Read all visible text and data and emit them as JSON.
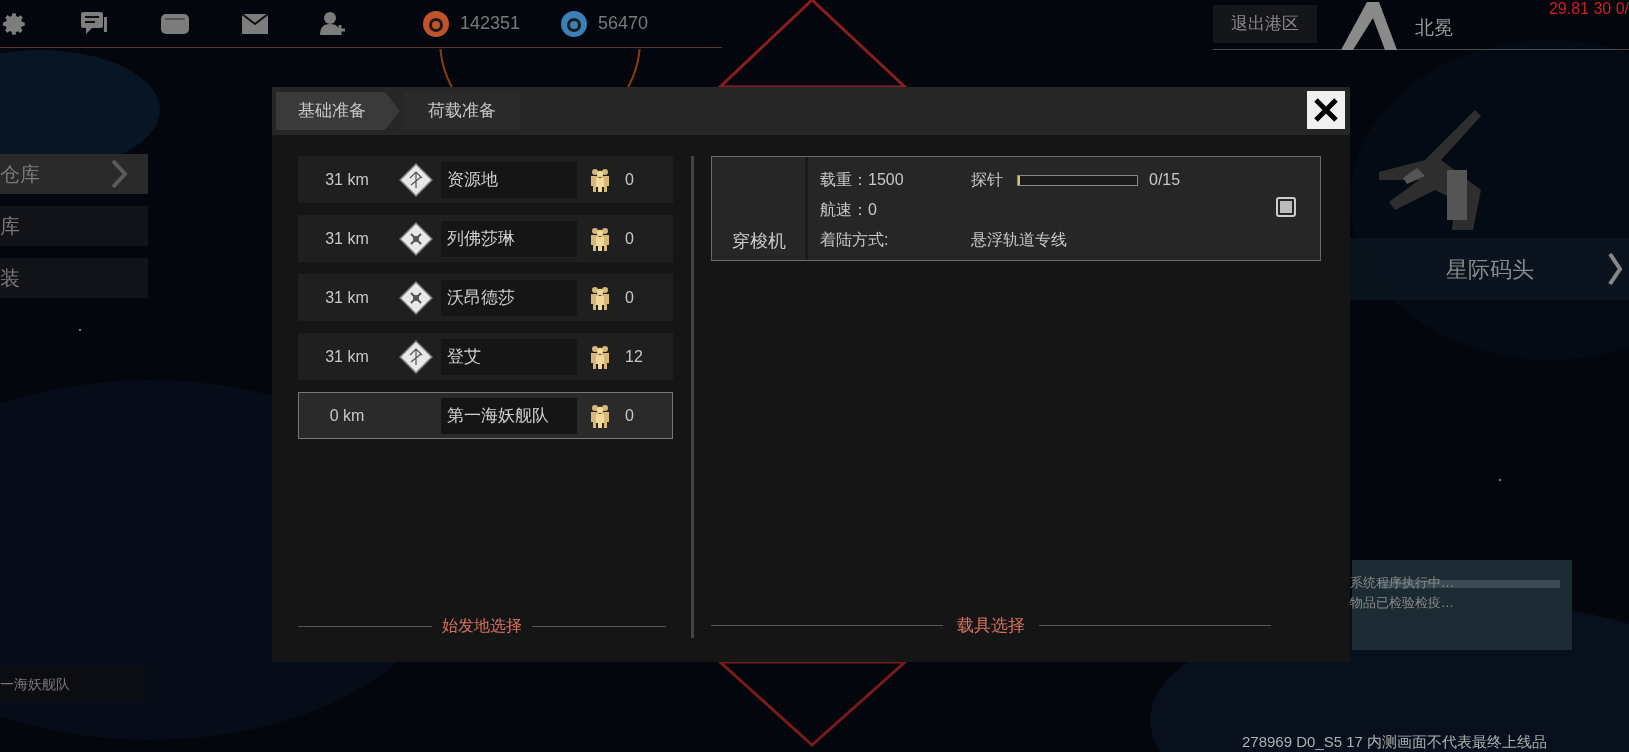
{
  "top_bar": {
    "currencies": [
      {
        "kind": "orange",
        "value": "142351"
      },
      {
        "kind": "blue",
        "value": "56470"
      }
    ],
    "exit_button": "退出港区",
    "location": "北冕",
    "debug_reading": "29.81 30 0/"
  },
  "side_menu": [
    {
      "label": "仓库",
      "selected": true
    },
    {
      "label": "库",
      "selected": false
    },
    {
      "label": "装",
      "selected": false
    }
  ],
  "fleet_label": "一海妖舰队",
  "dialog": {
    "tabs": [
      {
        "label": "基础准备",
        "selected": true
      },
      {
        "label": "荷载准备",
        "selected": false
      }
    ],
    "origins": [
      {
        "distance": "31 km",
        "kind": "route",
        "name": "资源地",
        "count": "0",
        "selected": false
      },
      {
        "distance": "31 km",
        "kind": "cross",
        "name": "列佛莎琳",
        "count": "0",
        "selected": false
      },
      {
        "distance": "31 km",
        "kind": "cross",
        "name": "沃昂德莎",
        "count": "0",
        "selected": false
      },
      {
        "distance": "31 km",
        "kind": "route",
        "name": "登艾",
        "count": "12",
        "selected": false
      },
      {
        "distance": "0 km",
        "kind": "fleet",
        "name": "第一海妖舰队",
        "count": "0",
        "selected": true
      }
    ],
    "origin_title": "始发地选择",
    "vehicle": {
      "name": "穿梭机",
      "load_label": "载重：1500",
      "speed_label": "航速：0",
      "landing_label": "着陆方式:",
      "probe_label": "探针",
      "level": 0.0,
      "probe_reading": "0/15",
      "landing_value": "悬浮轨道专线",
      "checked": true
    },
    "vehicle_title": "载具选择"
  },
  "dock": {
    "label": "星际码头"
  },
  "log_lines": [
    "系统程序执行中…",
    "物品已检验检疫…"
  ],
  "footer_note": "278969 D0_S5 17 内测画面不代表最终上线品"
}
